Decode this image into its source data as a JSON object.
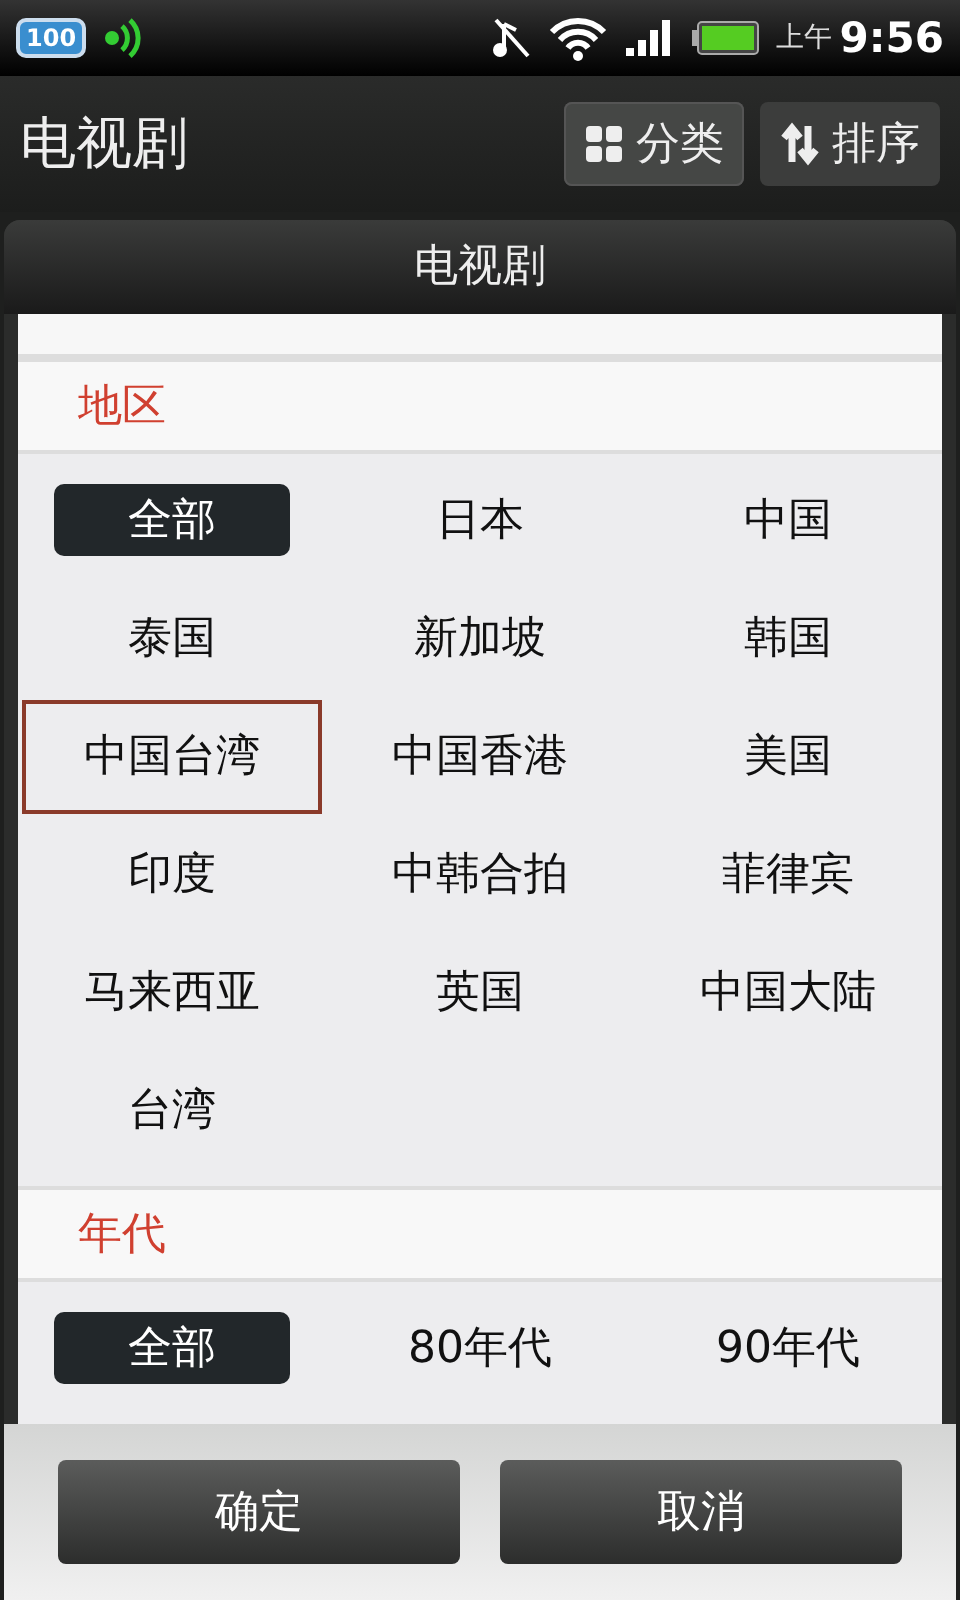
{
  "status_bar": {
    "badge": "100",
    "ampm": "上午",
    "time": "9:56"
  },
  "header": {
    "title": "电视剧",
    "buttons": [
      {
        "kind": "grid",
        "label": "分类",
        "selected": true
      },
      {
        "kind": "sort",
        "label": "排序",
        "selected": false
      }
    ]
  },
  "popup": {
    "title": "电视剧",
    "sections": [
      {
        "title": "地区",
        "options": [
          {
            "label": "全部",
            "selected": true,
            "focused": false
          },
          {
            "label": "日本",
            "selected": false,
            "focused": false
          },
          {
            "label": "中国",
            "selected": false,
            "focused": false
          },
          {
            "label": "泰国",
            "selected": false,
            "focused": false
          },
          {
            "label": "新加坡",
            "selected": false,
            "focused": false
          },
          {
            "label": "韩国",
            "selected": false,
            "focused": false
          },
          {
            "label": "中国台湾",
            "selected": false,
            "focused": true
          },
          {
            "label": "中国香港",
            "selected": false,
            "focused": false
          },
          {
            "label": "美国",
            "selected": false,
            "focused": false
          },
          {
            "label": "印度",
            "selected": false,
            "focused": false
          },
          {
            "label": "中韩合拍",
            "selected": false,
            "focused": false
          },
          {
            "label": "菲律宾",
            "selected": false,
            "focused": false
          },
          {
            "label": "马来西亚",
            "selected": false,
            "focused": false
          },
          {
            "label": "英国",
            "selected": false,
            "focused": false
          },
          {
            "label": "中国大陆",
            "selected": false,
            "focused": false
          },
          {
            "label": "台湾",
            "selected": false,
            "focused": false
          }
        ]
      },
      {
        "title": "年代",
        "options": [
          {
            "label": "全部",
            "selected": true,
            "focused": false
          },
          {
            "label": "80年代",
            "selected": false,
            "focused": false
          },
          {
            "label": "90年代",
            "selected": false,
            "focused": false
          }
        ]
      }
    ],
    "buttons": [
      "确定",
      "取消"
    ]
  }
}
